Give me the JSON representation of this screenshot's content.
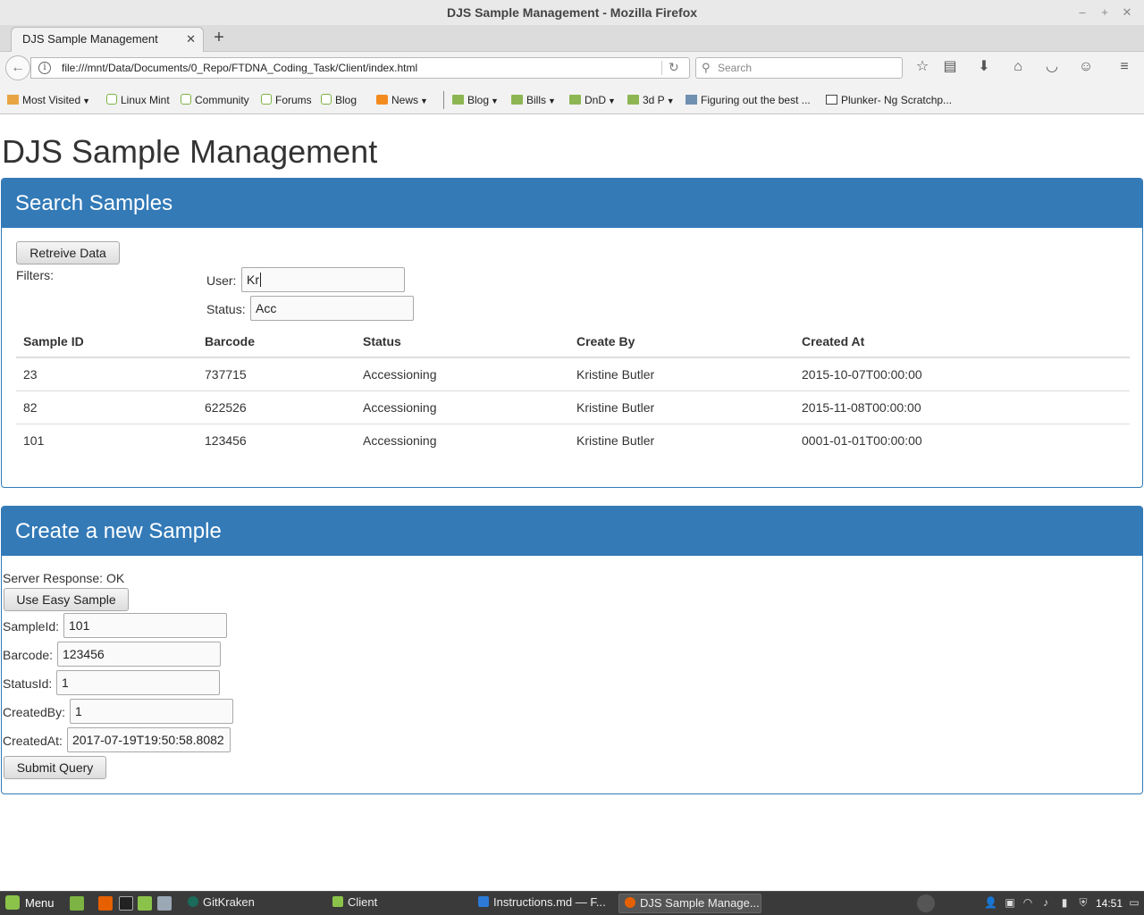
{
  "window": {
    "title": "DJS Sample Management - Mozilla Firefox"
  },
  "tab": {
    "title": "DJS Sample Management"
  },
  "url": "file:///mnt/Data/Documents/0_Repo/FTDNA_Coding_Task/Client/index.html",
  "search_placeholder": "Search",
  "bookmarks": [
    "Most Visited",
    "Linux Mint",
    "Community",
    "Forums",
    "Blog",
    "News",
    "Blog",
    "Bills",
    "DnD",
    "3d P",
    "Figuring out the best ...",
    "Plunker- Ng Scratchp..."
  ],
  "page": {
    "title": "DJS Sample Management",
    "search": {
      "heading": "Search Samples",
      "retrieve_label": "Retreive Data",
      "filters_label": "Filters:",
      "user_label": "User:",
      "user_value": "Kr",
      "status_label": "Status:",
      "status_value": "Acc",
      "columns": [
        "Sample ID",
        "Barcode",
        "Status",
        "Create By",
        "Created At"
      ],
      "rows": [
        [
          "23",
          "737715",
          "Accessioning",
          "Kristine Butler",
          "2015-10-07T00:00:00"
        ],
        [
          "82",
          "622526",
          "Accessioning",
          "Kristine Butler",
          "2015-11-08T00:00:00"
        ],
        [
          "101",
          "123456",
          "Accessioning",
          "Kristine Butler",
          "0001-01-01T00:00:00"
        ]
      ]
    },
    "create": {
      "heading": "Create a new Sample",
      "server_response": "Server Response: OK",
      "easy_sample_label": "Use Easy Sample",
      "sample_id_label": "SampleId:",
      "sample_id_value": "101",
      "barcode_label": "Barcode:",
      "barcode_value": "123456",
      "status_id_label": "StatusId:",
      "status_id_value": "1",
      "created_by_label": "CreatedBy:",
      "created_by_value": "1",
      "created_at_label": "CreatedAt:",
      "created_at_value": "2017-07-19T19:50:58.8082",
      "submit_label": "Submit Query"
    }
  },
  "taskbar": {
    "menu_label": "Menu",
    "tasks": [
      "GitKraken",
      "Client",
      "Instructions.md — F...",
      "DJS Sample Manage..."
    ],
    "clock": "14:51"
  },
  "colors": {
    "panel_primary": "#337ab7"
  }
}
